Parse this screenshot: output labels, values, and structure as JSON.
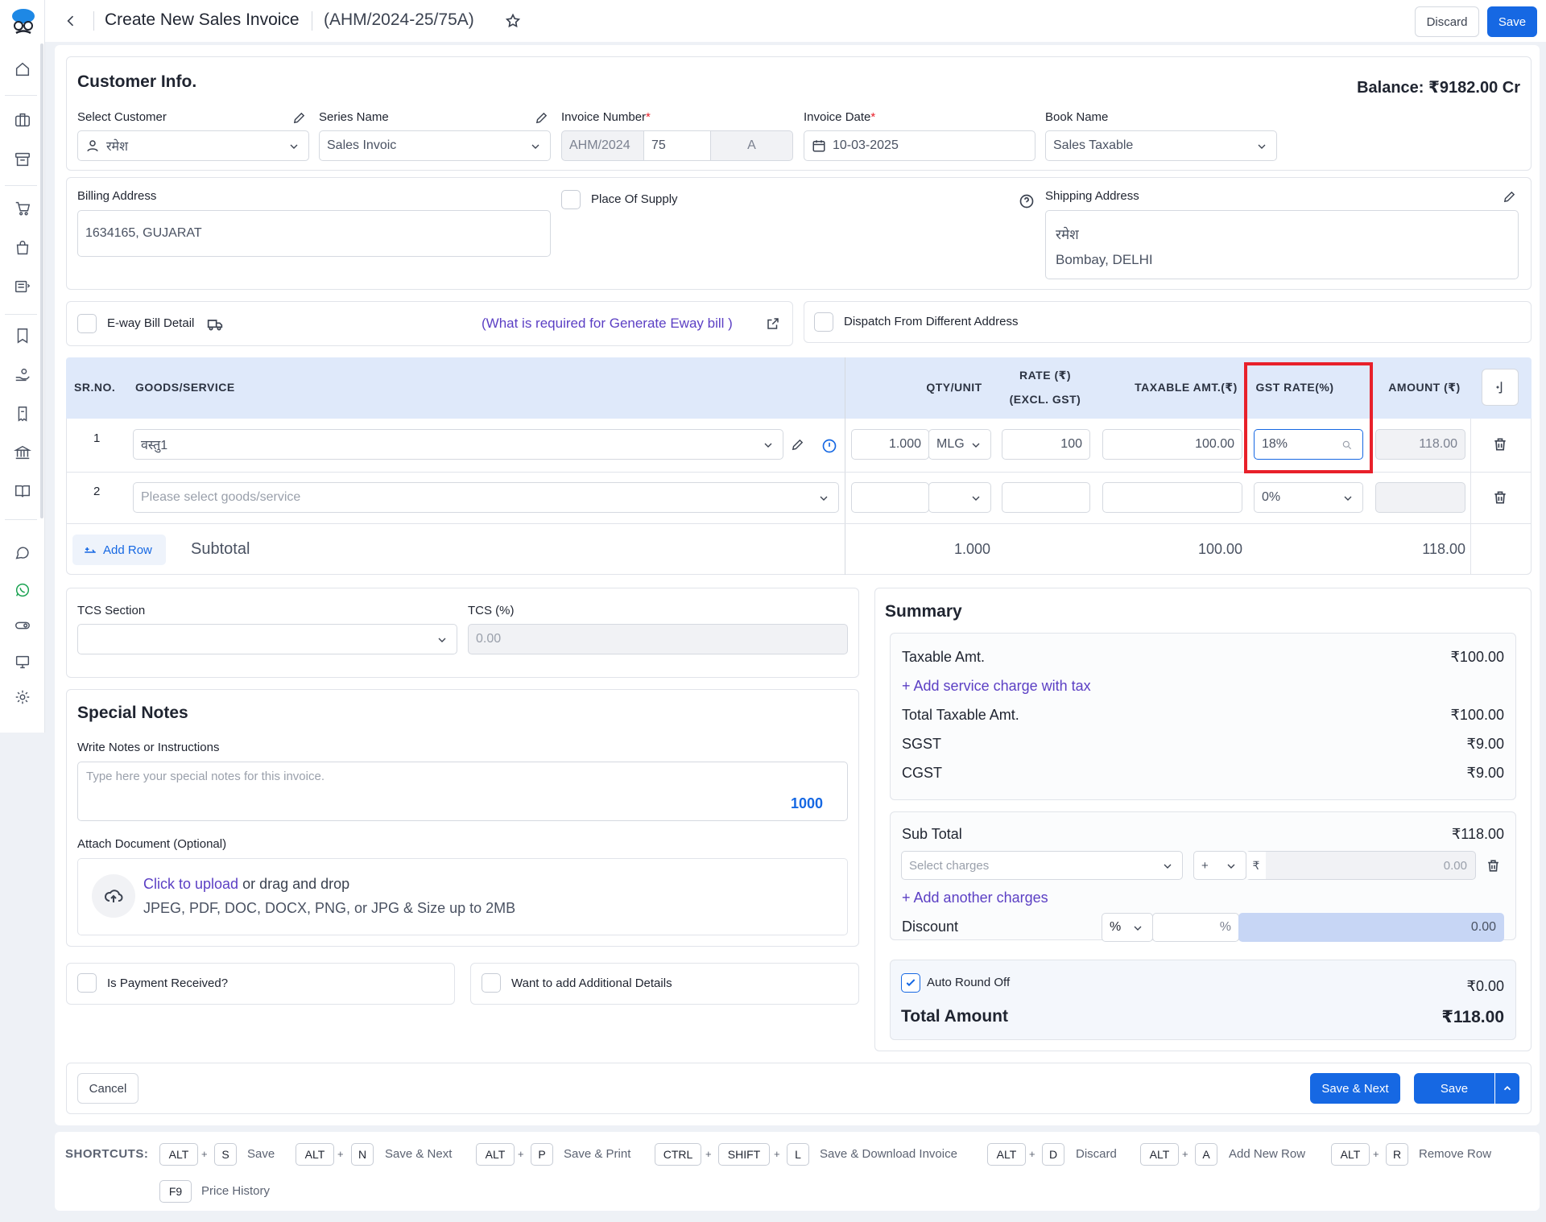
{
  "header": {
    "title": "Create New Sales Invoice",
    "invoice_code": "(AHM/2024-25/75A)",
    "discard": "Discard",
    "save": "Save"
  },
  "customer": {
    "heading": "Customer Info.",
    "balance": "Balance: ₹9182.00 Cr",
    "select_customer_label": "Select Customer",
    "customer_value": "रमेश",
    "series_label": "Series Name",
    "series_value": "Sales Invoic",
    "invoice_number_label": "Invoice Number",
    "inv_prefix": "AHM/2024",
    "inv_number": "75",
    "inv_suffix": "A",
    "invoice_date_label": "Invoice Date",
    "invoice_date": "10-03-2025",
    "book_label": "Book Name",
    "book_value": "Sales Taxable",
    "required": "*"
  },
  "address": {
    "billing_label": "Billing Address",
    "billing_value": "1634165, GUJARAT",
    "place_of_supply": "Place Of Supply",
    "shipping_label": "Shipping Address",
    "shipping_name": "रमेश",
    "shipping_city": "Bombay, DELHI"
  },
  "eway": {
    "label": "E-way Bill Detail",
    "link": "(What is required for Generate Eway bill )",
    "dispatch": "Dispatch From Different Address"
  },
  "table": {
    "headers": {
      "sr": "SR.NO.",
      "goods": "GOODS/SERVICE",
      "qty": "QTY/UNIT",
      "rate1": "RATE (₹)",
      "rate2": "(EXCL. GST)",
      "taxable": "TAXABLE AMT.(₹)",
      "gst": "GST RATE(%)",
      "amount": "AMOUNT (₹)"
    },
    "rows": [
      {
        "sr": "1",
        "goods": "वस्तु1",
        "qty": "1.000",
        "unit": "MLG",
        "rate": "100",
        "taxable": "100.00",
        "gst": "18%",
        "amount": "118.00"
      },
      {
        "sr": "2",
        "goods_placeholder": "Please select goods/service",
        "gst": "0%"
      }
    ],
    "add_row": "Add Row",
    "subtotal_label": "Subtotal",
    "subtotal_qty": "1.000",
    "subtotal_taxable": "100.00",
    "subtotal_amount": "118.00"
  },
  "tcs": {
    "section_label": "TCS Section",
    "percent_label": "TCS (%)",
    "percent_value": "0.00"
  },
  "notes": {
    "heading": "Special Notes",
    "label": "Write Notes or Instructions",
    "placeholder": "Type here your special notes for this invoice.",
    "counter": "1000",
    "attach_label": "Attach Document (Optional)",
    "upload_link": "Click to upload",
    "upload_rest": " or drag and drop",
    "upload_hint": "JPEG, PDF, DOC, DOCX, PNG, or JPG & Size up to 2MB"
  },
  "payment": {
    "received": "Is Payment Received?",
    "additional": "Want to add Additional Details"
  },
  "summary": {
    "heading": "Summary",
    "taxable_label": "Taxable Amt.",
    "taxable_value": "₹100.00",
    "add_service": "Add service charge with tax",
    "total_taxable_label": "Total Taxable Amt.",
    "total_taxable_value": "₹100.00",
    "sgst_label": "SGST",
    "sgst_value": "₹9.00",
    "cgst_label": "CGST",
    "cgst_value": "₹9.00",
    "subtotal_label": "Sub Total",
    "subtotal_value": "₹118.00",
    "charges_placeholder": "Select charges",
    "sign": "+",
    "rupee": "₹",
    "charge_value": "0.00",
    "add_another": "Add another charges",
    "discount_label": "Discount",
    "discount_type": "%",
    "discount_pct": "%",
    "discount_value": "0.00",
    "round_off_label": "Auto Round Off",
    "round_off_value": "₹0.00",
    "total_label": "Total Amount",
    "total_value": "₹118.00"
  },
  "footer": {
    "cancel": "Cancel",
    "save_next": "Save & Next",
    "save": "Save"
  },
  "shortcuts": {
    "title": "SHORTCUTS:",
    "items": [
      {
        "keys": [
          "ALT",
          "S"
        ],
        "label": "Save"
      },
      {
        "keys": [
          "ALT",
          "N"
        ],
        "label": "Save & Next"
      },
      {
        "keys": [
          "ALT",
          "P"
        ],
        "label": "Save & Print"
      },
      {
        "keys": [
          "CTRL",
          "SHIFT",
          "L"
        ],
        "label": "Save & Download Invoice"
      },
      {
        "keys": [
          "ALT",
          "D"
        ],
        "label": "Discard"
      },
      {
        "keys": [
          "ALT",
          "A"
        ],
        "label": "Add New Row"
      },
      {
        "keys": [
          "ALT",
          "R"
        ],
        "label": "Remove Row"
      },
      {
        "keys": [
          "F9"
        ],
        "label": "Price History"
      }
    ]
  },
  "colors": {
    "primary": "#1668e3",
    "highlight": "#e8202a",
    "link": "#5b3fc4",
    "header_bg": "#dfe9fa"
  }
}
